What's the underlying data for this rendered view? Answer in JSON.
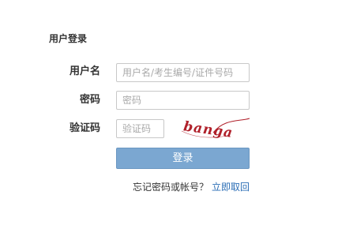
{
  "panel": {
    "title": "用户登录"
  },
  "form": {
    "username": {
      "label": "用户名",
      "placeholder": "用户名/考生编号/证件号码",
      "value": ""
    },
    "password": {
      "label": "密码",
      "placeholder": "密码",
      "value": ""
    },
    "captcha": {
      "label": "验证码",
      "placeholder": "验证码",
      "value": "",
      "image_text": "banga"
    },
    "submit_label": "登录"
  },
  "footer": {
    "forgot_text": "忘记密码或帐号？",
    "retrieve_link": "立即取回"
  },
  "colors": {
    "button_bg": "#7ba7d1",
    "link": "#2a6db5",
    "captcha_text": "#b0202a"
  }
}
